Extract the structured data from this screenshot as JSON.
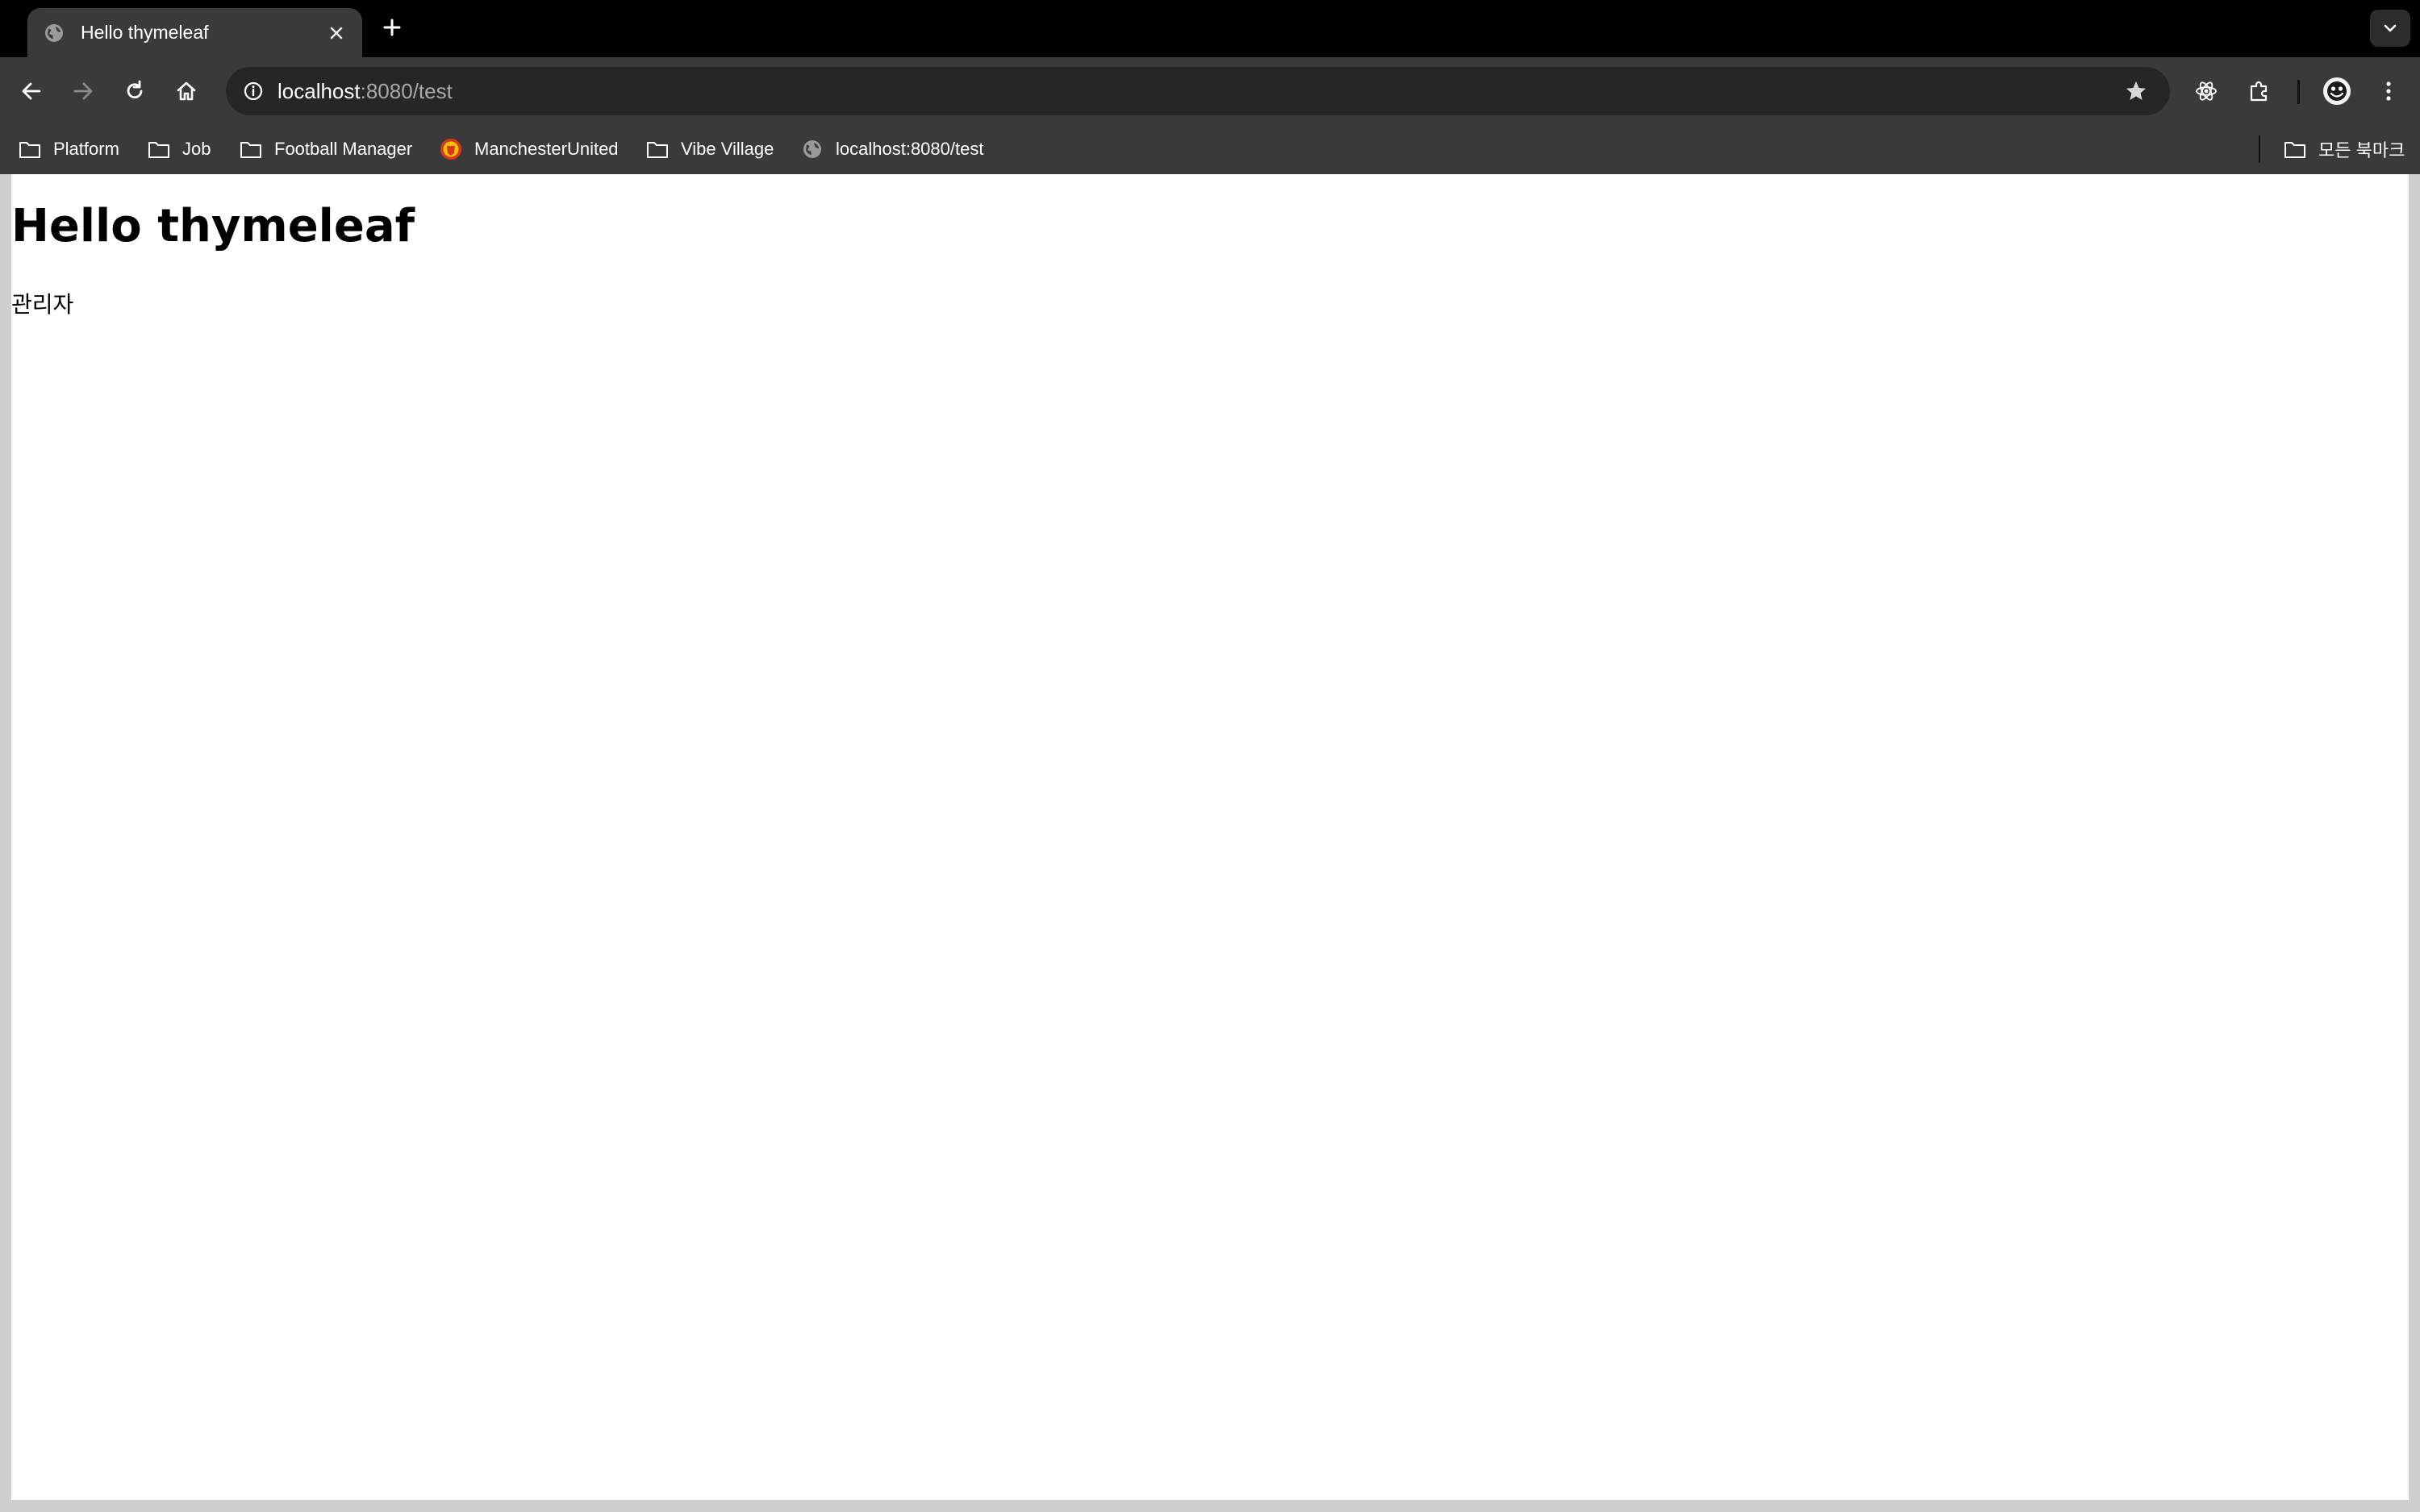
{
  "tab": {
    "title": "Hello thymeleaf",
    "favicon": "globe-icon"
  },
  "omnibox": {
    "host": "localhost",
    "path": ":8080/test"
  },
  "bookmarks": [
    {
      "label": "Platform",
      "icon": "folder-icon"
    },
    {
      "label": "Job",
      "icon": "folder-icon"
    },
    {
      "label": "Football Manager",
      "icon": "folder-icon"
    },
    {
      "label": "ManchesterUnited",
      "icon": "club-crest-icon"
    },
    {
      "label": "Vibe Village",
      "icon": "folder-icon"
    },
    {
      "label": "localhost:8080/test",
      "icon": "globe-icon"
    }
  ],
  "all_bookmarks": {
    "label": "모든 북마크",
    "icon": "folder-icon"
  },
  "page": {
    "heading": "Hello thymeleaf",
    "text": "관리자"
  },
  "colors": {
    "tabstrip": "#000000",
    "toolbar": "#3a3a3a",
    "omnibox": "#262626",
    "page": "#ffffff",
    "crest": "#d9381e"
  }
}
